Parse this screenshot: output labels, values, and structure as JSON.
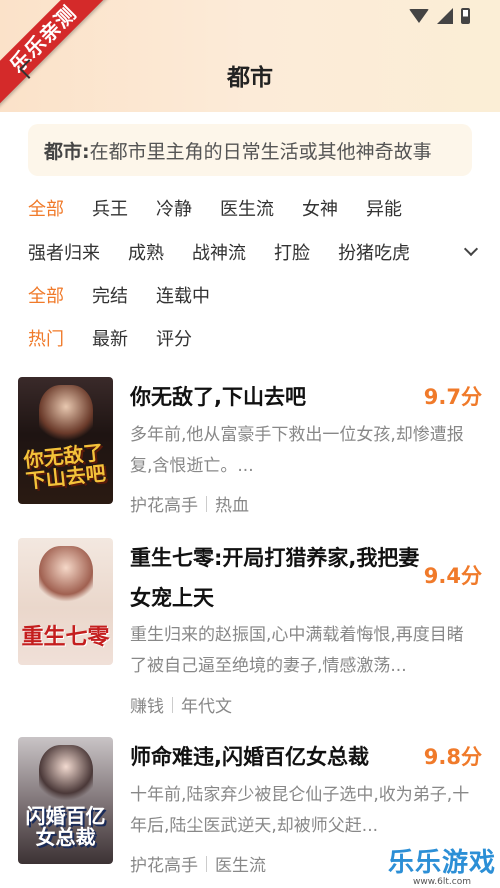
{
  "header": {
    "title": "都市",
    "ribbon": "乐乐亲测"
  },
  "description": {
    "label": "都市:",
    "text": "在都市里主角的日常生活或其他神奇故事"
  },
  "filters": {
    "tags": [
      "全部",
      "兵王",
      "冷静",
      "医生流",
      "女神",
      "异能"
    ],
    "tags_row2": [
      "强者归来",
      "成熟",
      "战神流",
      "打脸",
      "扮猪吃虎"
    ],
    "status": [
      "全部",
      "完结",
      "连载中"
    ],
    "sort": [
      "热门",
      "最新",
      "评分"
    ]
  },
  "books": [
    {
      "title": "你无敌了,下山去吧",
      "cover_title": "你无敌了下山去吧",
      "score": "9.7分",
      "desc": "多年前,他从富豪手下救出一位女孩,却惨遭报复,含恨逝亡。...",
      "tags": [
        "护花高手",
        "热血"
      ]
    },
    {
      "title": "重生七零:开局打猎养家,我把妻女宠上天",
      "cover_title": "重生七零",
      "score": "9.4分",
      "desc": "重生归来的赵振国,心中满载着悔恨,再度目睹了被自己逼至绝境的妻子,情感激荡...",
      "tags": [
        "赚钱",
        "年代文"
      ]
    },
    {
      "title": "师命难违,闪婚百亿女总裁",
      "cover_title": "闪婚百亿女总裁",
      "score": "9.8分",
      "desc": "十年前,陆家弃少被昆仑仙子选中,收为弟子,十年后,陆尘医武逆天,却被师父赶...",
      "tags": [
        "护花高手",
        "医生流"
      ]
    }
  ],
  "watermark": {
    "text": "乐乐游戏",
    "url": "www.6lt.com"
  },
  "colors": {
    "accent": "#f07a2a",
    "ribbon": "#d42a2a"
  }
}
